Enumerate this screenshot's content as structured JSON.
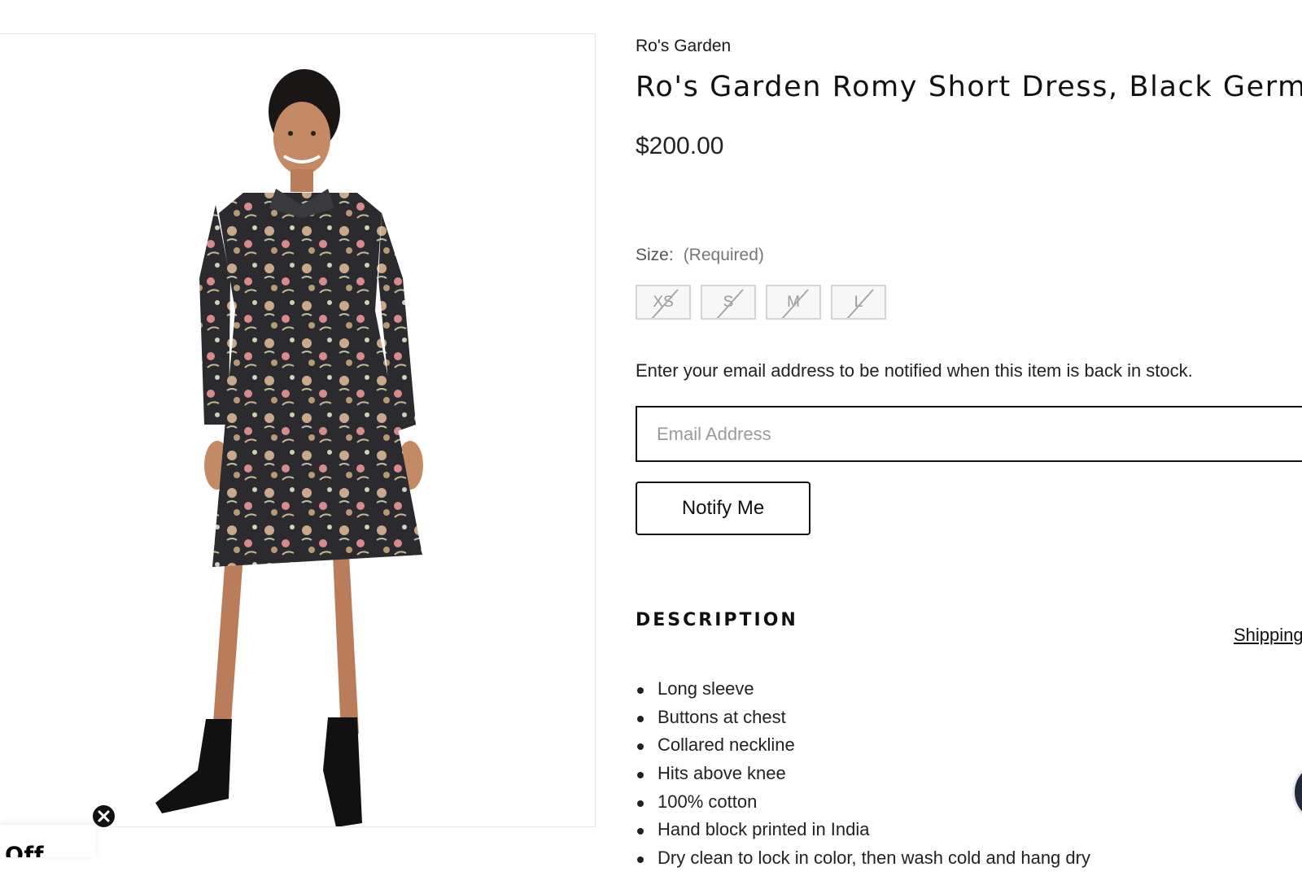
{
  "product": {
    "vendor": "Ro's Garden",
    "title": "Ro's Garden Romy Short Dress, Black Germain",
    "price": "$200.00",
    "image_icon": "product-photo-dress"
  },
  "size": {
    "label": "Size:",
    "required_text": "(Required)",
    "options": [
      "XS",
      "S",
      "M",
      "L"
    ],
    "all_unavailable": true
  },
  "notify": {
    "message": "Enter your email address to be notified when this item is back in stock.",
    "email_placeholder": "Email Address",
    "button_label": "Notify Me"
  },
  "description": {
    "heading": "DESCRIPTION",
    "shipping_link": "Shipping",
    "bullets": [
      "Long sleeve",
      "Buttons at chest",
      "Collared neckline",
      "Hits above knee",
      "100% cotton",
      "Hand block printed in India",
      "Dry clean to lock in color, then wash cold and hang dry"
    ]
  },
  "promo": {
    "tab_text": "Off",
    "close_icon": "close-icon"
  },
  "colors": {
    "text": "#111111",
    "muted": "#9a9a9a",
    "border": "#111111",
    "dress": "#2b2b2f"
  }
}
